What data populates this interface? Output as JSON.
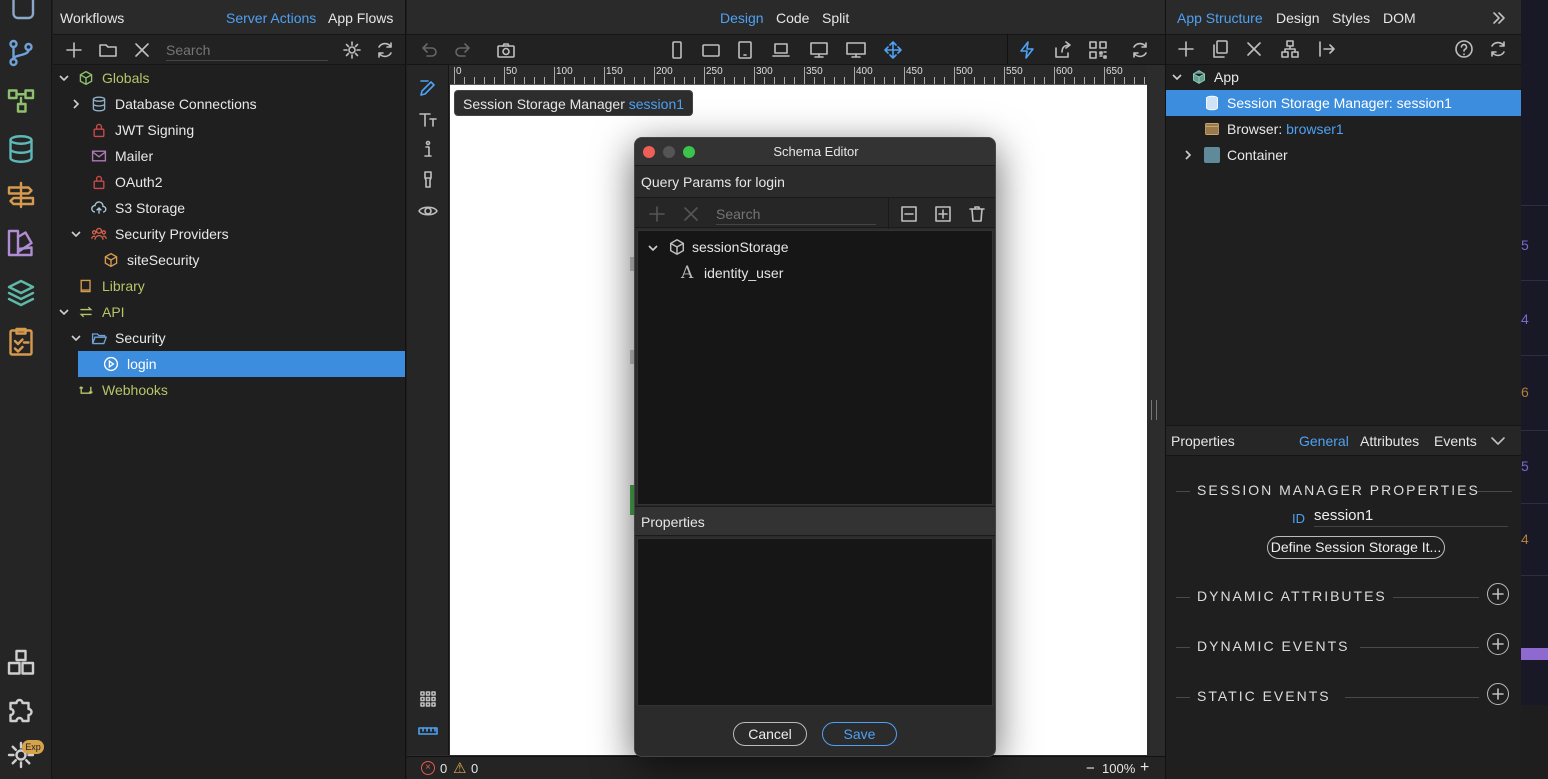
{
  "rail": {
    "icons": [
      "pages-icon",
      "git-branch-icon",
      "workflow-icon",
      "database-icon",
      "signpost-icon",
      "palette-icon",
      "layers-icon",
      "clipboard-check-icon",
      "extensions-icon",
      "puzzle-icon",
      "settings-icon"
    ],
    "badge": "Exp"
  },
  "workflows": {
    "title": "Workflows",
    "tabs": [
      "Server Actions",
      "App Flows"
    ],
    "search_placeholder": "Search",
    "tree": [
      {
        "label": "Globals",
        "level": 0,
        "expanded": true,
        "icon": "cube-icon",
        "color": "#b6c46a"
      },
      {
        "label": "Database Connections",
        "level": 1,
        "expanded": false,
        "icon": "database-icon",
        "color": "#e8e8e8"
      },
      {
        "label": "JWT Signing",
        "level": 1,
        "icon": "lock-icon",
        "color": "#e8e8e8"
      },
      {
        "label": "Mailer",
        "level": 1,
        "icon": "mail-icon",
        "color": "#e8e8e8"
      },
      {
        "label": "OAuth2",
        "level": 1,
        "icon": "lock-icon",
        "color": "#e8e8e8"
      },
      {
        "label": "S3 Storage",
        "level": 1,
        "icon": "cloud-upload-icon",
        "color": "#e8e8e8"
      },
      {
        "label": "Security Providers",
        "level": 1,
        "expanded": true,
        "icon": "users-icon",
        "color": "#e8e8e8"
      },
      {
        "label": "siteSecurity",
        "level": 2,
        "icon": "package-icon",
        "color": "#e8e8e8"
      },
      {
        "label": "Library",
        "level": 0,
        "icon": "book-icon",
        "color": "#b6c46a"
      },
      {
        "label": "API",
        "level": 0,
        "expanded": true,
        "icon": "arrows-exchange-icon",
        "color": "#b6c46a"
      },
      {
        "label": "Security",
        "level": 1,
        "expanded": true,
        "icon": "folder-open-icon",
        "color": "#e8e8e8"
      },
      {
        "label": "login",
        "level": 2,
        "icon": "play-circle-icon",
        "color": "#ffffff",
        "selected": true
      },
      {
        "label": "Webhooks",
        "level": 0,
        "icon": "webhook-icon",
        "color": "#b6c46a"
      }
    ]
  },
  "design": {
    "tabs": [
      "Design",
      "Code",
      "Split"
    ],
    "active_tab": "Design",
    "tooltip": {
      "label": "Session Storage Manager",
      "id": "session1"
    },
    "ruler_labels": [
      "0",
      "50",
      "100",
      "150",
      "200",
      "250",
      "300",
      "350",
      "400",
      "450",
      "500",
      "550",
      "600",
      "650"
    ],
    "status": {
      "errors": "0",
      "warnings": "0",
      "zoom": "100%",
      "minus": "−",
      "plus": "+"
    }
  },
  "dialog": {
    "title": "Schema Editor",
    "subtitle": "Query Params for login",
    "search_placeholder": "Search",
    "tree": [
      {
        "label": "sessionStorage",
        "icon": "cube-outline-icon"
      },
      {
        "label": "identity_user",
        "icon": "text-type-icon"
      }
    ],
    "properties_title": "Properties",
    "cancel_label": "Cancel",
    "save_label": "Save"
  },
  "structure": {
    "tabs": [
      "App Structure",
      "Design",
      "Styles",
      "DOM"
    ],
    "tree": [
      {
        "label": "App",
        "level": 0
      },
      {
        "label": "Session Storage Manager: session1",
        "level": 1,
        "selected": true
      },
      {
        "label": "Browser: ",
        "id": "browser1",
        "level": 1
      },
      {
        "label": "Container",
        "level": 1
      }
    ]
  },
  "properties": {
    "title": "Properties",
    "tabs": [
      "General",
      "Attributes",
      "Events"
    ],
    "section_title": "SESSION MANAGER PROPERTIES",
    "id_label": "ID",
    "id_value": "session1",
    "define_button": "Define Session Storage It...",
    "dynamic_attributes": "DYNAMIC ATTRIBUTES",
    "dynamic_events": "DYNAMIC EVENTS",
    "static_events": "STATIC EVENTS"
  },
  "edge_digits": [
    "5",
    "4",
    "6",
    "5",
    "4"
  ],
  "colors": {
    "accent": "#4ea1f3",
    "selection": "#3c8dde",
    "green_label": "#b6c46a"
  }
}
